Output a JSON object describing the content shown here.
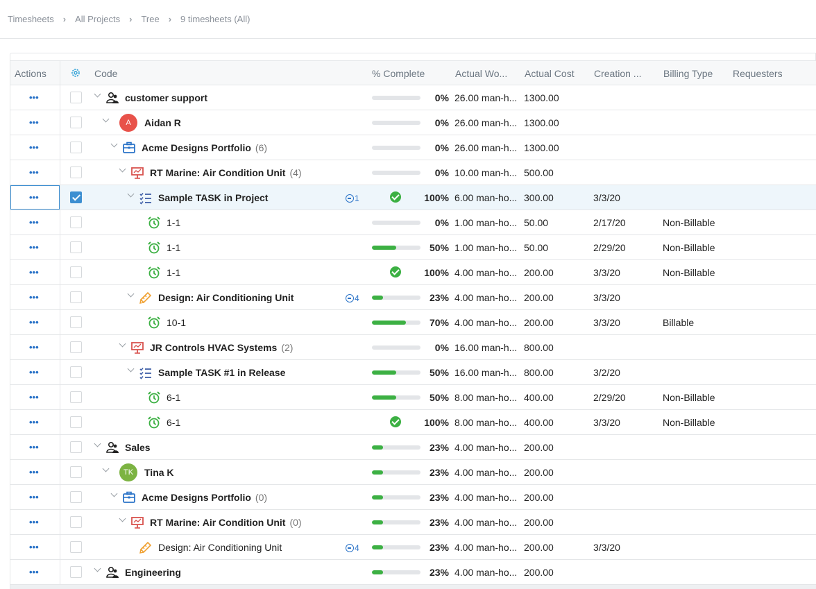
{
  "breadcrumb": [
    "Timesheets",
    "All Projects",
    "Tree",
    "9 timesheets (All)"
  ],
  "columns": {
    "actions": "Actions",
    "code": "Code",
    "pct": "% Complete",
    "work": "Actual Wo...",
    "cost": "Actual Cost",
    "creation": "Creation ...",
    "billing": "Billing Type",
    "requesters": "Requesters"
  },
  "colors": {
    "accent": "#2a73c8",
    "progress": "#3cb043",
    "avatar_aidan": "#e8524a",
    "avatar_tina": "#7cb342"
  },
  "rows": [
    {
      "icon": "team-icon",
      "name": "customer support",
      "count": "",
      "pct_label": "0%",
      "pct": 0,
      "work": "26.00 man-h...",
      "cost": "1300.00",
      "date": "",
      "billing": "",
      "bold": true
    },
    {
      "icon": "avatar",
      "avatar": "A",
      "name": "Aidan  R",
      "count": "",
      "pct_label": "0%",
      "pct": 0,
      "work": "26.00 man-h...",
      "cost": "1300.00",
      "date": "",
      "billing": "",
      "bold": true
    },
    {
      "icon": "portfolio-icon",
      "name": "Acme Designs  Portfolio",
      "count": "(6)",
      "pct_label": "0%",
      "pct": 0,
      "work": "26.00 man-h...",
      "cost": "1300.00",
      "date": "",
      "billing": "",
      "bold": true
    },
    {
      "icon": "project-icon",
      "name": "RT Marine: Air Condition Unit",
      "count": "(4)",
      "pct_label": "0%",
      "pct": 0,
      "work": "10.00 man-h...",
      "cost": "500.00",
      "date": "",
      "billing": "",
      "bold": true
    },
    {
      "icon": "task-list-icon",
      "name": "Sample TASK in Project",
      "count": "",
      "sub": "1",
      "pct_label": "100%",
      "pct": 100,
      "work": "6.00 man-ho...",
      "cost": "300.00",
      "date": "3/3/20",
      "billing": "",
      "bold": true,
      "selected": true
    },
    {
      "icon": "alarm-clock-icon",
      "name": "1-1",
      "count": "",
      "pct_label": "0%",
      "pct": 0,
      "work": "1.00 man-ho...",
      "cost": "50.00",
      "date": "2/17/20",
      "billing": "Non-Billable",
      "bold": false
    },
    {
      "icon": "alarm-clock-icon",
      "name": "1-1",
      "count": "",
      "pct_label": "50%",
      "pct": 50,
      "work": "1.00 man-ho...",
      "cost": "50.00",
      "date": "2/29/20",
      "billing": "Non-Billable",
      "bold": false
    },
    {
      "icon": "alarm-clock-icon",
      "name": "1-1",
      "count": "",
      "pct_label": "100%",
      "pct": 100,
      "work": "4.00 man-ho...",
      "cost": "200.00",
      "date": "3/3/20",
      "billing": "Non-Billable",
      "bold": false
    },
    {
      "icon": "design-icon",
      "name": "Design: Air Conditioning Unit",
      "count": "",
      "sub": "4",
      "pct_label": "23%",
      "pct": 23,
      "work": "4.00 man-ho...",
      "cost": "200.00",
      "date": "3/3/20",
      "billing": "",
      "bold": true
    },
    {
      "icon": "alarm-clock-icon",
      "name": "10-1",
      "count": "",
      "pct_label": "70%",
      "pct": 70,
      "work": "4.00 man-ho...",
      "cost": "200.00",
      "date": "3/3/20",
      "billing": "Billable",
      "bold": false
    },
    {
      "icon": "project-icon",
      "name": "JR Controls HVAC Systems",
      "count": "(2)",
      "pct_label": "0%",
      "pct": 0,
      "work": "16.00 man-h...",
      "cost": "800.00",
      "date": "",
      "billing": "",
      "bold": true
    },
    {
      "icon": "task-list-icon",
      "name": "Sample TASK #1 in Release",
      "count": "",
      "pct_label": "50%",
      "pct": 50,
      "work": "16.00 man-h...",
      "cost": "800.00",
      "date": "3/2/20",
      "billing": "",
      "bold": true
    },
    {
      "icon": "alarm-clock-icon",
      "name": "6-1",
      "count": "",
      "pct_label": "50%",
      "pct": 50,
      "work": "8.00 man-ho...",
      "cost": "400.00",
      "date": "2/29/20",
      "billing": "Non-Billable",
      "bold": false
    },
    {
      "icon": "alarm-clock-icon",
      "name": "6-1",
      "count": "",
      "pct_label": "100%",
      "pct": 100,
      "work": "8.00 man-ho...",
      "cost": "400.00",
      "date": "3/3/20",
      "billing": "Non-Billable",
      "bold": false
    },
    {
      "icon": "team-icon",
      "name": "Sales",
      "count": "",
      "pct_label": "23%",
      "pct": 23,
      "work": "4.00 man-ho...",
      "cost": "200.00",
      "date": "",
      "billing": "",
      "bold": true
    },
    {
      "icon": "avatar",
      "avatar": "TK",
      "name": "Tina K",
      "count": "",
      "pct_label": "23%",
      "pct": 23,
      "work": "4.00 man-ho...",
      "cost": "200.00",
      "date": "",
      "billing": "",
      "bold": true
    },
    {
      "icon": "portfolio-icon",
      "name": "Acme Designs  Portfolio",
      "count": "(0)",
      "pct_label": "23%",
      "pct": 23,
      "work": "4.00 man-ho...",
      "cost": "200.00",
      "date": "",
      "billing": "",
      "bold": true
    },
    {
      "icon": "project-icon",
      "name": "RT Marine: Air Condition Unit",
      "count": "(0)",
      "pct_label": "23%",
      "pct": 23,
      "work": "4.00 man-ho...",
      "cost": "200.00",
      "date": "",
      "billing": "",
      "bold": true
    },
    {
      "icon": "design-icon",
      "name": "Design: Air Conditioning Unit",
      "count": "",
      "sub": "4",
      "pct_label": "23%",
      "pct": 23,
      "work": "4.00 man-ho...",
      "cost": "200.00",
      "date": "3/3/20",
      "billing": "",
      "bold": false
    },
    {
      "icon": "team-icon",
      "name": "Engineering",
      "count": "",
      "pct_label": "23%",
      "pct": 23,
      "work": "4.00 man-ho...",
      "cost": "200.00",
      "date": "",
      "billing": "",
      "bold": true
    }
  ]
}
